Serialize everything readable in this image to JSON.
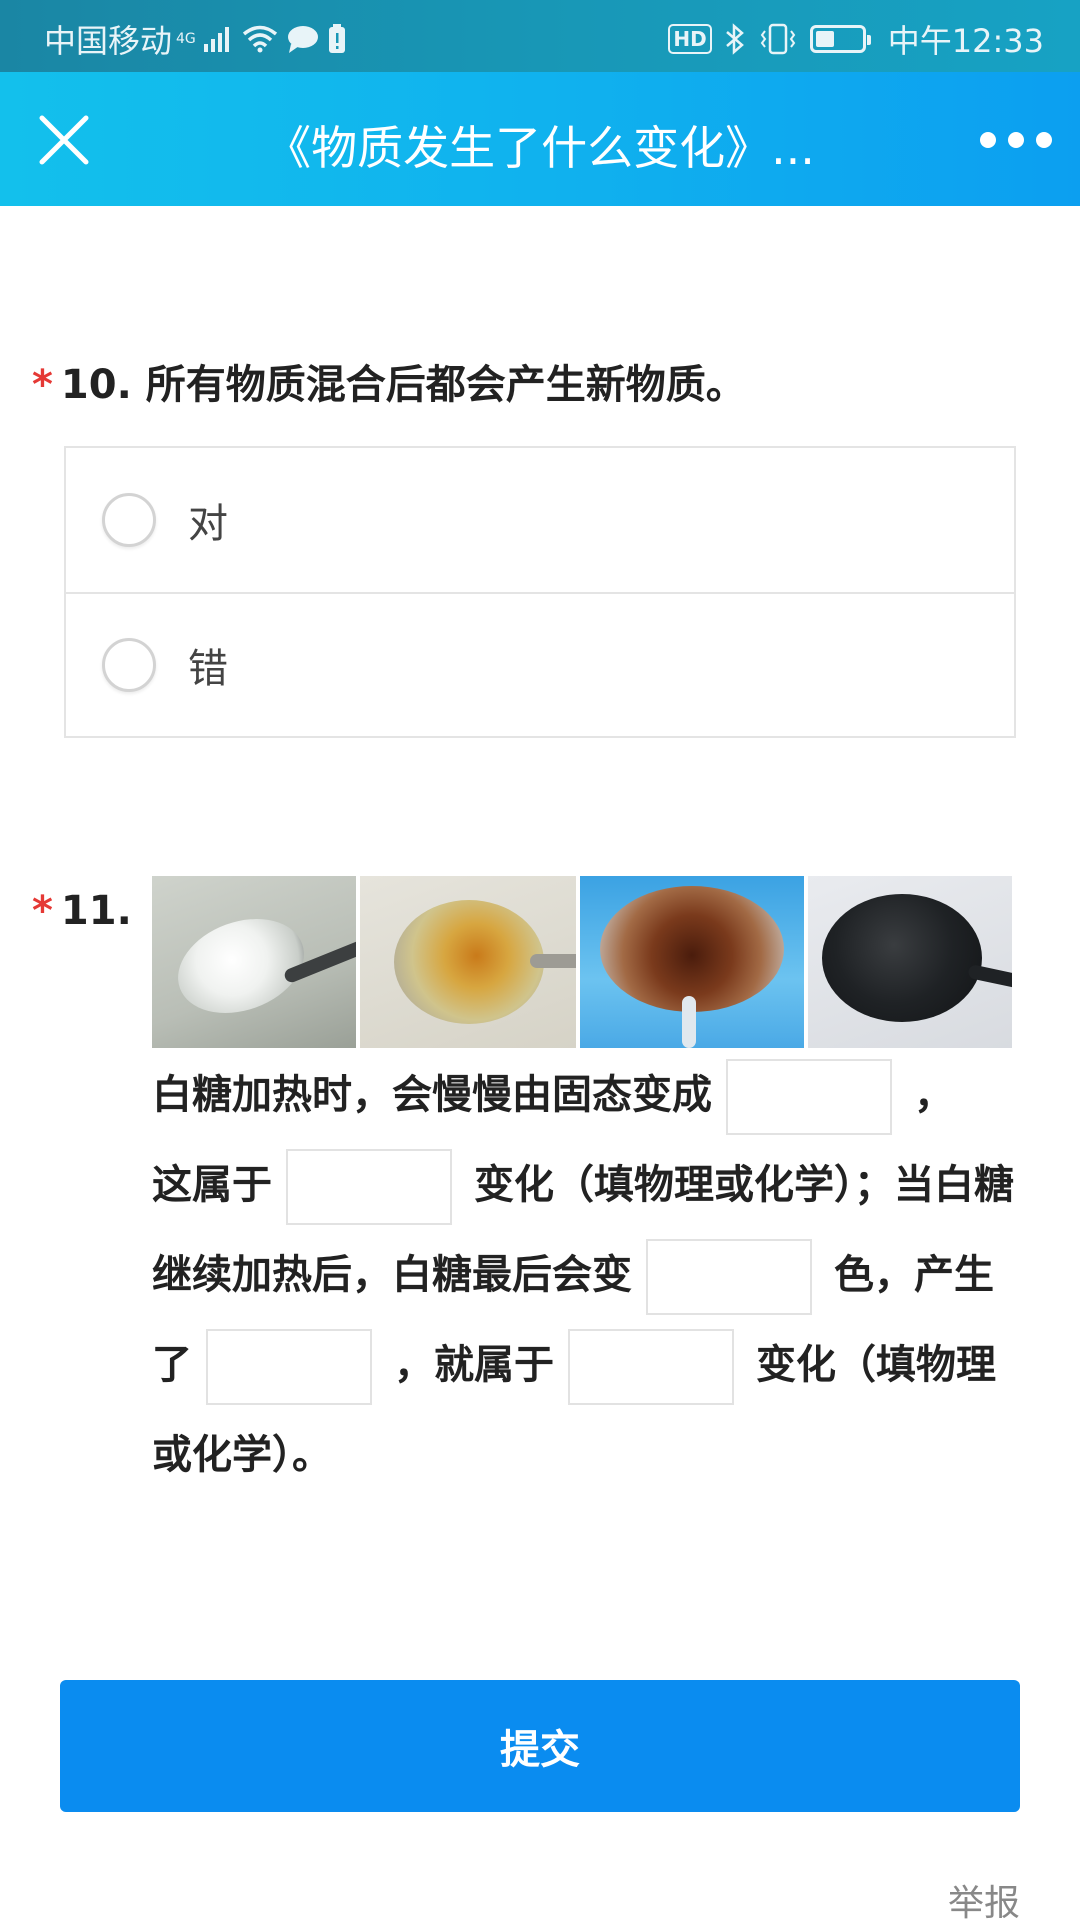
{
  "status_bar": {
    "carrier": "中国移动",
    "network": "4G",
    "time": "中午12:33",
    "hd_label": "HD",
    "battery_level": 0.4
  },
  "header": {
    "title": "《物质发生了什么变化》...",
    "close_icon": "close-icon",
    "more_icon": "more-icon"
  },
  "questions": [
    {
      "required_mark": "*",
      "number": "10.",
      "text": "所有物质混合后都会产生新物质。",
      "options": [
        {
          "label": "对"
        },
        {
          "label": "错"
        }
      ]
    },
    {
      "required_mark": "*",
      "number": "11.",
      "segments": [
        "白糖加热时，会慢慢由固态变成",
        "，",
        "这属于",
        "变化（填物理或化学）；当白糖继续加热后，白糖最后会变",
        "色，产生了",
        "，就属于",
        "变化（填物理或化学）。"
      ]
    }
  ],
  "footer": {
    "submit_label": "提交",
    "report_label": "举报"
  },
  "colors": {
    "status_bar": "#1897b6",
    "title_bar": "#10b2ee",
    "submit": "#0a8cf0",
    "required": "#e53935"
  }
}
